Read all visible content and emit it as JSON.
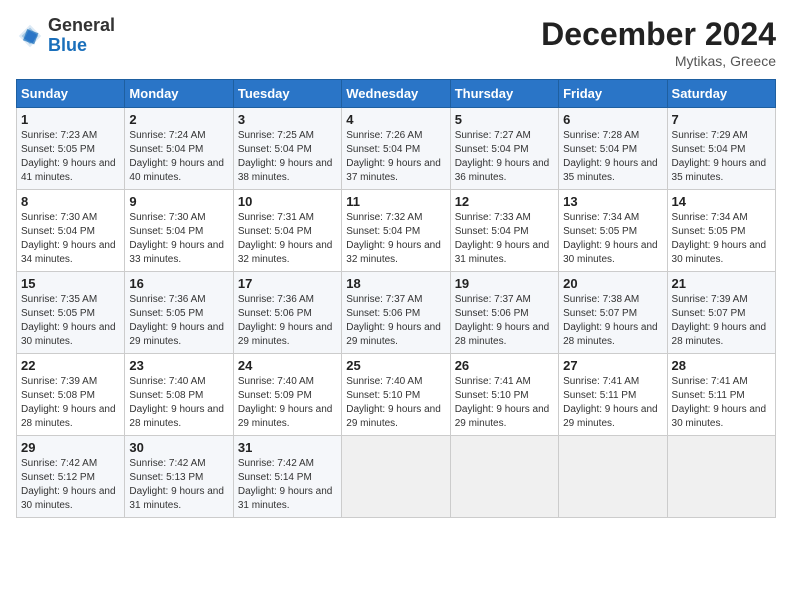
{
  "logo": {
    "general": "General",
    "blue": "Blue"
  },
  "header": {
    "month": "December 2024",
    "location": "Mytikas, Greece"
  },
  "weekdays": [
    "Sunday",
    "Monday",
    "Tuesday",
    "Wednesday",
    "Thursday",
    "Friday",
    "Saturday"
  ],
  "weeks": [
    [
      {
        "day": "1",
        "sunrise": "Sunrise: 7:23 AM",
        "sunset": "Sunset: 5:05 PM",
        "daylight": "Daylight: 9 hours and 41 minutes."
      },
      {
        "day": "2",
        "sunrise": "Sunrise: 7:24 AM",
        "sunset": "Sunset: 5:04 PM",
        "daylight": "Daylight: 9 hours and 40 minutes."
      },
      {
        "day": "3",
        "sunrise": "Sunrise: 7:25 AM",
        "sunset": "Sunset: 5:04 PM",
        "daylight": "Daylight: 9 hours and 38 minutes."
      },
      {
        "day": "4",
        "sunrise": "Sunrise: 7:26 AM",
        "sunset": "Sunset: 5:04 PM",
        "daylight": "Daylight: 9 hours and 37 minutes."
      },
      {
        "day": "5",
        "sunrise": "Sunrise: 7:27 AM",
        "sunset": "Sunset: 5:04 PM",
        "daylight": "Daylight: 9 hours and 36 minutes."
      },
      {
        "day": "6",
        "sunrise": "Sunrise: 7:28 AM",
        "sunset": "Sunset: 5:04 PM",
        "daylight": "Daylight: 9 hours and 35 minutes."
      },
      {
        "day": "7",
        "sunrise": "Sunrise: 7:29 AM",
        "sunset": "Sunset: 5:04 PM",
        "daylight": "Daylight: 9 hours and 35 minutes."
      }
    ],
    [
      {
        "day": "8",
        "sunrise": "Sunrise: 7:30 AM",
        "sunset": "Sunset: 5:04 PM",
        "daylight": "Daylight: 9 hours and 34 minutes."
      },
      {
        "day": "9",
        "sunrise": "Sunrise: 7:30 AM",
        "sunset": "Sunset: 5:04 PM",
        "daylight": "Daylight: 9 hours and 33 minutes."
      },
      {
        "day": "10",
        "sunrise": "Sunrise: 7:31 AM",
        "sunset": "Sunset: 5:04 PM",
        "daylight": "Daylight: 9 hours and 32 minutes."
      },
      {
        "day": "11",
        "sunrise": "Sunrise: 7:32 AM",
        "sunset": "Sunset: 5:04 PM",
        "daylight": "Daylight: 9 hours and 32 minutes."
      },
      {
        "day": "12",
        "sunrise": "Sunrise: 7:33 AM",
        "sunset": "Sunset: 5:04 PM",
        "daylight": "Daylight: 9 hours and 31 minutes."
      },
      {
        "day": "13",
        "sunrise": "Sunrise: 7:34 AM",
        "sunset": "Sunset: 5:05 PM",
        "daylight": "Daylight: 9 hours and 30 minutes."
      },
      {
        "day": "14",
        "sunrise": "Sunrise: 7:34 AM",
        "sunset": "Sunset: 5:05 PM",
        "daylight": "Daylight: 9 hours and 30 minutes."
      }
    ],
    [
      {
        "day": "15",
        "sunrise": "Sunrise: 7:35 AM",
        "sunset": "Sunset: 5:05 PM",
        "daylight": "Daylight: 9 hours and 30 minutes."
      },
      {
        "day": "16",
        "sunrise": "Sunrise: 7:36 AM",
        "sunset": "Sunset: 5:05 PM",
        "daylight": "Daylight: 9 hours and 29 minutes."
      },
      {
        "day": "17",
        "sunrise": "Sunrise: 7:36 AM",
        "sunset": "Sunset: 5:06 PM",
        "daylight": "Daylight: 9 hours and 29 minutes."
      },
      {
        "day": "18",
        "sunrise": "Sunrise: 7:37 AM",
        "sunset": "Sunset: 5:06 PM",
        "daylight": "Daylight: 9 hours and 29 minutes."
      },
      {
        "day": "19",
        "sunrise": "Sunrise: 7:37 AM",
        "sunset": "Sunset: 5:06 PM",
        "daylight": "Daylight: 9 hours and 28 minutes."
      },
      {
        "day": "20",
        "sunrise": "Sunrise: 7:38 AM",
        "sunset": "Sunset: 5:07 PM",
        "daylight": "Daylight: 9 hours and 28 minutes."
      },
      {
        "day": "21",
        "sunrise": "Sunrise: 7:39 AM",
        "sunset": "Sunset: 5:07 PM",
        "daylight": "Daylight: 9 hours and 28 minutes."
      }
    ],
    [
      {
        "day": "22",
        "sunrise": "Sunrise: 7:39 AM",
        "sunset": "Sunset: 5:08 PM",
        "daylight": "Daylight: 9 hours and 28 minutes."
      },
      {
        "day": "23",
        "sunrise": "Sunrise: 7:40 AM",
        "sunset": "Sunset: 5:08 PM",
        "daylight": "Daylight: 9 hours and 28 minutes."
      },
      {
        "day": "24",
        "sunrise": "Sunrise: 7:40 AM",
        "sunset": "Sunset: 5:09 PM",
        "daylight": "Daylight: 9 hours and 29 minutes."
      },
      {
        "day": "25",
        "sunrise": "Sunrise: 7:40 AM",
        "sunset": "Sunset: 5:10 PM",
        "daylight": "Daylight: 9 hours and 29 minutes."
      },
      {
        "day": "26",
        "sunrise": "Sunrise: 7:41 AM",
        "sunset": "Sunset: 5:10 PM",
        "daylight": "Daylight: 9 hours and 29 minutes."
      },
      {
        "day": "27",
        "sunrise": "Sunrise: 7:41 AM",
        "sunset": "Sunset: 5:11 PM",
        "daylight": "Daylight: 9 hours and 29 minutes."
      },
      {
        "day": "28",
        "sunrise": "Sunrise: 7:41 AM",
        "sunset": "Sunset: 5:11 PM",
        "daylight": "Daylight: 9 hours and 30 minutes."
      }
    ],
    [
      {
        "day": "29",
        "sunrise": "Sunrise: 7:42 AM",
        "sunset": "Sunset: 5:12 PM",
        "daylight": "Daylight: 9 hours and 30 minutes."
      },
      {
        "day": "30",
        "sunrise": "Sunrise: 7:42 AM",
        "sunset": "Sunset: 5:13 PM",
        "daylight": "Daylight: 9 hours and 31 minutes."
      },
      {
        "day": "31",
        "sunrise": "Sunrise: 7:42 AM",
        "sunset": "Sunset: 5:14 PM",
        "daylight": "Daylight: 9 hours and 31 minutes."
      },
      null,
      null,
      null,
      null
    ]
  ]
}
